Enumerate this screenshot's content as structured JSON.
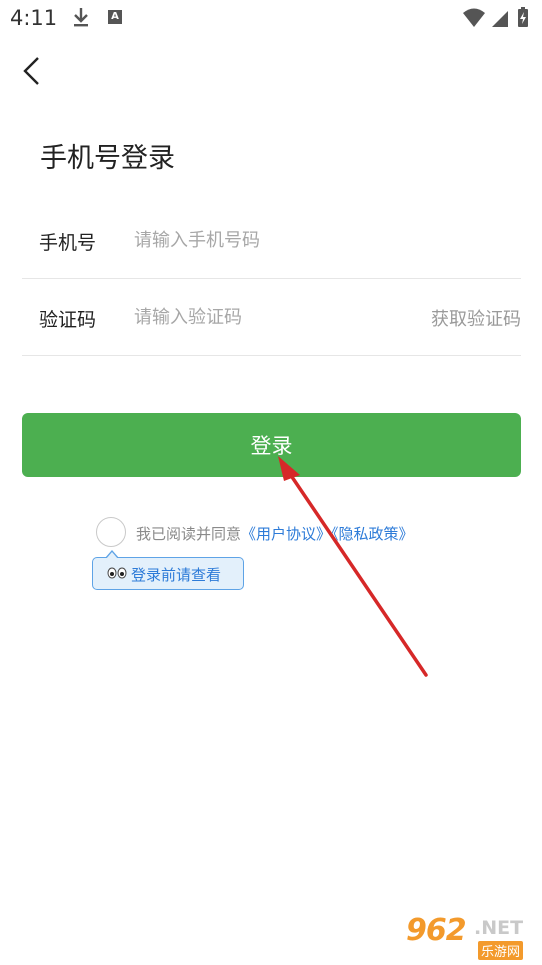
{
  "status_bar": {
    "time": "4:11",
    "icons": [
      "download-icon",
      "a-notification-icon",
      "wifi-icon",
      "signal-icon",
      "battery-charging-icon"
    ]
  },
  "header": {
    "back_icon": "chevron-left-icon",
    "title": "手机号登录"
  },
  "form": {
    "phone": {
      "label": "手机号",
      "placeholder": "请输入手机号码",
      "value": ""
    },
    "code": {
      "label": "验证码",
      "placeholder": "请输入验证码",
      "value": "",
      "get_code_label": "获取验证码"
    }
  },
  "login_button": {
    "label": "登录",
    "color": "#4caf50"
  },
  "agreement": {
    "prefix": "我已阅读并同意",
    "user_agreement": "《用户协议》",
    "privacy_policy": "《隐私政策》",
    "checked": false
  },
  "tooltip": {
    "text": "登录前请查看"
  },
  "watermark": {
    "number": "962",
    "suffix": ".NET",
    "site": "乐游网"
  },
  "colors": {
    "accent_green": "#4caf50",
    "link_blue": "#2d7bd8",
    "annotation_red": "#d62828",
    "watermark_orange": "#f39a2c"
  }
}
